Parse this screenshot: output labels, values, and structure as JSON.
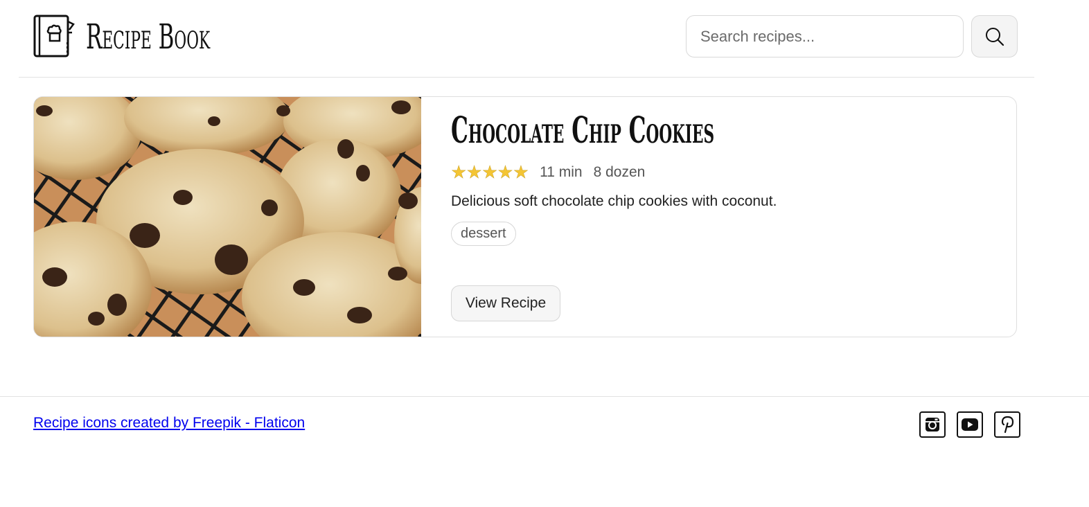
{
  "header": {
    "title": "Recipe Book",
    "logo_icon": "recipe-book-icon",
    "search": {
      "placeholder": "Search recipes...",
      "value": "",
      "button_icon": "search-icon"
    }
  },
  "recipes": [
    {
      "title": "Chocolate Chip Cookies",
      "rating": 5,
      "rating_max": 5,
      "time": "11 min",
      "yield": "8 dozen",
      "description": "Delicious soft chocolate chip cookies with coconut.",
      "tags": [
        "dessert"
      ],
      "button_label": "View Recipe",
      "image_subject": "chocolate chip cookies on cooling rack"
    }
  ],
  "footer": {
    "credit_link": "Recipe icons created by Freepik - Flaticon",
    "socials": [
      "instagram-icon",
      "youtube-icon",
      "pinterest-icon"
    ]
  },
  "colors": {
    "star": "#f4c534",
    "link": "#0000ee",
    "border": "#dedede"
  }
}
